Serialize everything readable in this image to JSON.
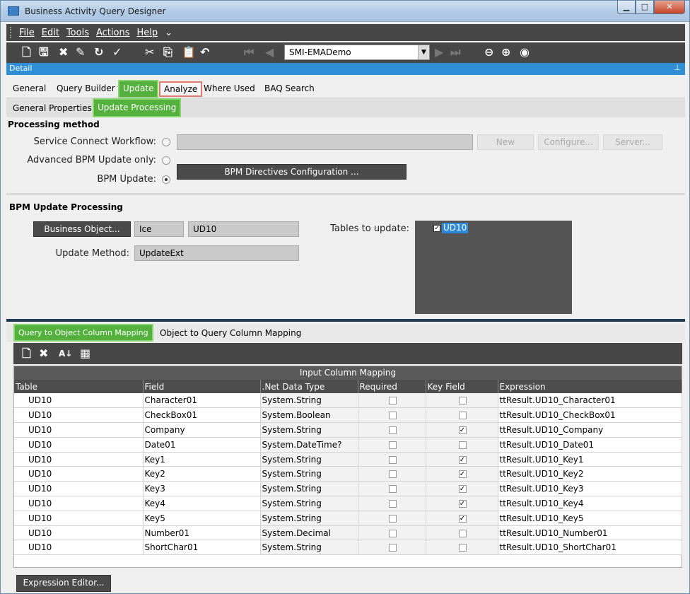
{
  "window": {
    "title": "Business Activity Query Designer"
  },
  "menu": [
    "File",
    "Edit",
    "Tools",
    "Actions",
    "Help"
  ],
  "toolbar": {
    "company_combo": "SMI-EMADemo"
  },
  "detail_label": "Detail",
  "main_tabs": [
    "General",
    "Query Builder",
    "Update",
    "Analyze",
    "Where Used",
    "BAQ Search"
  ],
  "sub_tabs": [
    "General Properties",
    "Update Processing"
  ],
  "processing": {
    "heading": "Processing method",
    "service_connect_label": "Service Connect Workflow:",
    "advanced_bpm_label": "Advanced BPM Update only:",
    "bpm_update_label": "BPM Update:",
    "new_button": "New",
    "configure_button": "Configure...",
    "server_button": "Server...",
    "bpm_directives_button": "BPM Directives Configuration ..."
  },
  "bpm": {
    "heading": "BPM Update Processing",
    "business_object_button": "Business Object...",
    "bo_system": "Ice",
    "bo_name": "UD10",
    "update_method_label": "Update Method:",
    "update_method": "UpdateExt",
    "tables_label": "Tables to update:",
    "tables": [
      "UD10"
    ]
  },
  "mapping_tabs": [
    "Query to Object Column Mapping",
    "Object to Query Column Mapping"
  ],
  "grid": {
    "caption": "Input Column Mapping",
    "columns": [
      "Table",
      "Field",
      ".Net Data Type",
      "Required",
      "Key Field",
      "Expression"
    ],
    "rows": [
      {
        "table": "UD10",
        "field": "Character01",
        "type": "System.String",
        "required": false,
        "key": false,
        "expr": "ttResult.UD10_Character01"
      },
      {
        "table": "UD10",
        "field": "CheckBox01",
        "type": "System.Boolean",
        "required": false,
        "key": false,
        "expr": "ttResult.UD10_CheckBox01"
      },
      {
        "table": "UD10",
        "field": "Company",
        "type": "System.String",
        "required": false,
        "key": true,
        "expr": "ttResult.UD10_Company"
      },
      {
        "table": "UD10",
        "field": "Date01",
        "type": "System.DateTime?",
        "required": false,
        "key": false,
        "expr": "ttResult.UD10_Date01"
      },
      {
        "table": "UD10",
        "field": "Key1",
        "type": "System.String",
        "required": false,
        "key": true,
        "expr": "ttResult.UD10_Key1"
      },
      {
        "table": "UD10",
        "field": "Key2",
        "type": "System.String",
        "required": false,
        "key": true,
        "expr": "ttResult.UD10_Key2"
      },
      {
        "table": "UD10",
        "field": "Key3",
        "type": "System.String",
        "required": false,
        "key": true,
        "expr": "ttResult.UD10_Key3"
      },
      {
        "table": "UD10",
        "field": "Key4",
        "type": "System.String",
        "required": false,
        "key": true,
        "expr": "ttResult.UD10_Key4"
      },
      {
        "table": "UD10",
        "field": "Key5",
        "type": "System.String",
        "required": false,
        "key": true,
        "expr": "ttResult.UD10_Key5"
      },
      {
        "table": "UD10",
        "field": "Number01",
        "type": "System.Decimal",
        "required": false,
        "key": false,
        "expr": "ttResult.UD10_Number01"
      },
      {
        "table": "UD10",
        "field": "ShortChar01",
        "type": "System.String",
        "required": false,
        "key": false,
        "expr": "ttResult.UD10_ShortChar01"
      }
    ]
  },
  "expression_editor_button": "Expression Editor...",
  "colors": {
    "accent_green": "#55b13d",
    "detail_blue": "#2f8fd6",
    "dark_bar": "#474747"
  }
}
